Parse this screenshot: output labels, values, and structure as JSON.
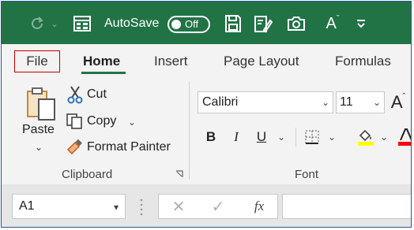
{
  "title_bar": {
    "autosave_label": "AutoSave",
    "autosave_state": "Off",
    "icons": [
      "redo-icon",
      "form-icon",
      "save-icon",
      "touch-mode-icon",
      "camera-icon",
      "font-color-icon",
      "customize-qat-icon"
    ],
    "font_icon_glyph": "A",
    "background_color": "#217346"
  },
  "tabs": [
    {
      "label": "File"
    },
    {
      "label": "Home",
      "selected": true
    },
    {
      "label": "Insert"
    },
    {
      "label": "Page Layout"
    },
    {
      "label": "Formulas"
    }
  ],
  "clipboard": {
    "paste_label": "Paste",
    "cut_label": "Cut",
    "copy_label": "Copy",
    "format_painter_label": "Format Painter",
    "group_label": "Clipboard"
  },
  "font": {
    "font_name": "Calibri",
    "font_size": "11",
    "grow_glyph": "A",
    "bold_glyph": "B",
    "italic_glyph": "I",
    "underline_glyph": "U",
    "fill_color": "#ffff00",
    "font_color": "#ff0000",
    "group_label": "Font"
  },
  "formula_bar": {
    "name_box_value": "A1",
    "fx_glyph": "fx"
  }
}
